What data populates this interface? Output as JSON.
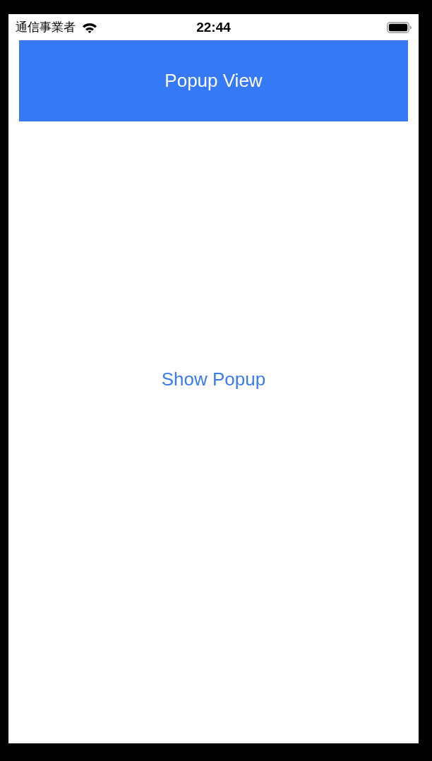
{
  "status_bar": {
    "carrier": "通信事業者",
    "time": "22:44"
  },
  "banner": {
    "title": "Popup View"
  },
  "show_popup_button": {
    "label": "Show Popup"
  }
}
